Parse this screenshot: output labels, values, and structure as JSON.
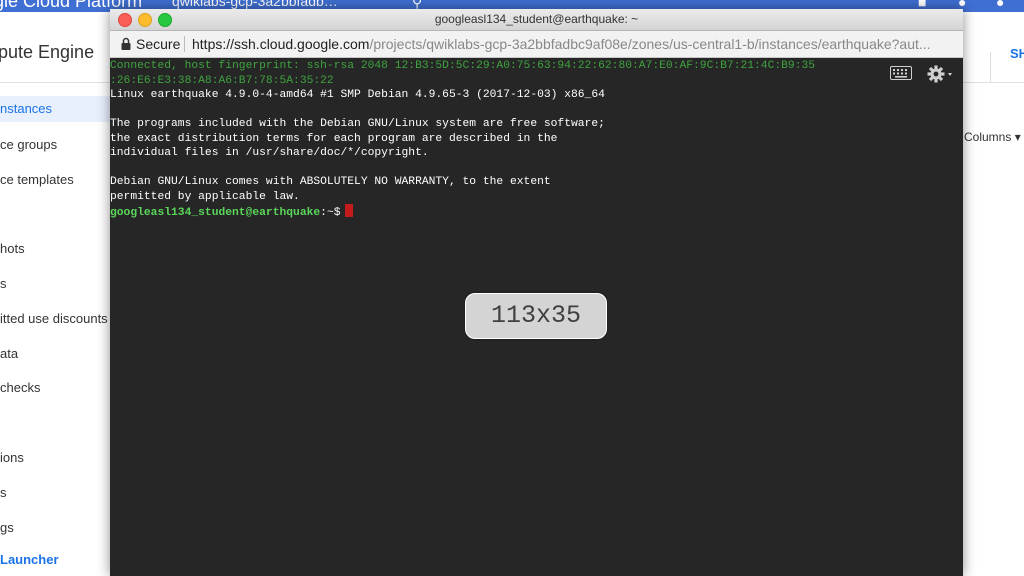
{
  "gcp": {
    "brand": "gle Cloud Platform",
    "project": "qwiklabs-gcp-3a2bbfadb…",
    "product_title": "pute Engine",
    "share_label": "SH",
    "columns_label": "Columns",
    "nav": [
      {
        "label": "nstances",
        "active": true
      },
      {
        "label": "ce groups"
      },
      {
        "label": "ce templates"
      },
      {
        "label": "hots"
      },
      {
        "label": "s"
      },
      {
        "label": "itted use discounts"
      },
      {
        "label": "ata"
      },
      {
        "label": " checks"
      },
      {
        "label": "ions"
      },
      {
        "label": "s"
      },
      {
        "label": "gs"
      },
      {
        "label": "Launcher"
      }
    ]
  },
  "ssh": {
    "window_title": "googleasl134_student@earthquake: ~",
    "secure_label": "Secure",
    "url_domain": "https://ssh.cloud.google.com",
    "url_path": "/projects/qwiklabs-gcp-3a2bbfadbc9af08e/zones/us-central1-b/instances/earthquake?aut...",
    "terminal_lines": [
      {
        "text": "Connected, host fingerprint: ssh-rsa 2048 12:B3:5D:5C:29:A0:75:63:94:22:62:80:A7:E0:AF:9C:B7:21:4C:B9:35",
        "style": "green"
      },
      {
        "text": ":26:E6:E3:38:A8:A6:B7:78:5A:35:22",
        "style": "green"
      },
      {
        "text": "Linux earthquake 4.9.0-4-amd64 #1 SMP Debian 4.9.65-3 (2017-12-03) x86_64"
      },
      {
        "text": ""
      },
      {
        "text": "The programs included with the Debian GNU/Linux system are free software;"
      },
      {
        "text": "the exact distribution terms for each program are described in the"
      },
      {
        "text": "individual files in /usr/share/doc/*/copyright."
      },
      {
        "text": ""
      },
      {
        "text": "Debian GNU/Linux comes with ABSOLUTELY NO WARRANTY, to the extent"
      },
      {
        "text": "permitted by applicable law."
      }
    ],
    "prompt_user": "googleasl134_student@earthquake",
    "prompt_suffix": ":~$",
    "size_overlay": "113x35"
  },
  "colors": {
    "gcp_blue": "#3f6fd2",
    "terminal_bg": "#262626",
    "prompt_green": "#5ad65a",
    "cursor_red": "#c41a1a"
  }
}
